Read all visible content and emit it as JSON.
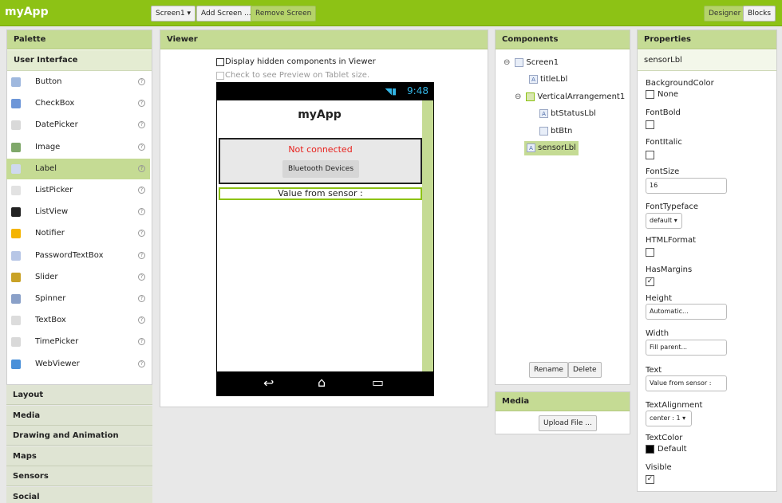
{
  "app": {
    "title": "myApp"
  },
  "toolbar": {
    "screen_select": "Screen1 ▾",
    "add_screen": "Add Screen ...",
    "remove_screen": "Remove Screen",
    "designer": "Designer",
    "blocks": "Blocks"
  },
  "palette": {
    "title": "Palette",
    "section": "User Interface",
    "items": [
      {
        "label": "Button",
        "icon": "button-icon"
      },
      {
        "label": "CheckBox",
        "icon": "checkbox-icon"
      },
      {
        "label": "DatePicker",
        "icon": "datepicker-icon"
      },
      {
        "label": "Image",
        "icon": "image-icon"
      },
      {
        "label": "Label",
        "icon": "label-icon",
        "selected": true
      },
      {
        "label": "ListPicker",
        "icon": "listpicker-icon"
      },
      {
        "label": "ListView",
        "icon": "listview-icon"
      },
      {
        "label": "Notifier",
        "icon": "notifier-icon"
      },
      {
        "label": "PasswordTextBox",
        "icon": "password-icon"
      },
      {
        "label": "Slider",
        "icon": "slider-icon"
      },
      {
        "label": "Spinner",
        "icon": "spinner-icon"
      },
      {
        "label": "TextBox",
        "icon": "textbox-icon"
      },
      {
        "label": "TimePicker",
        "icon": "timepicker-icon"
      },
      {
        "label": "WebViewer",
        "icon": "webviewer-icon"
      }
    ],
    "categories": [
      "Layout",
      "Media",
      "Drawing and Animation",
      "Maps",
      "Sensors",
      "Social"
    ]
  },
  "viewer": {
    "title": "Viewer",
    "hidden_checkbox": "Display hidden components in Viewer",
    "tablet_checkbox": "Check to see Preview on Tablet size.",
    "phone": {
      "time": "9:48",
      "screen_title": "myApp",
      "status": "Not connected",
      "bt_button": "Bluetooth Devices",
      "sensor_text": "Value from sensor :"
    }
  },
  "components": {
    "title": "Components",
    "tree": {
      "screen": "Screen1",
      "title_lbl": "titleLbl",
      "arrangement": "VerticalArrangement1",
      "bt_status": "btStatusLbl",
      "bt_btn": "btBtn",
      "sensor_lbl": "sensorLbl"
    },
    "rename": "Rename",
    "delete": "Delete"
  },
  "media": {
    "title": "Media",
    "upload": "Upload File ..."
  },
  "properties": {
    "title": "Properties",
    "component": "sensorLbl",
    "bg_label": "BackgroundColor",
    "bg_value": "None",
    "fontbold_label": "FontBold",
    "fontitalic_label": "FontItalic",
    "fontsize_label": "FontSize",
    "fontsize_value": "16",
    "typeface_label": "FontTypeface",
    "typeface_value": "default ▾",
    "html_label": "HTMLFormat",
    "margins_label": "HasMargins",
    "height_label": "Height",
    "height_value": "Automatic...",
    "width_label": "Width",
    "width_value": "Fill parent...",
    "text_label": "Text",
    "text_value": "Value from sensor :",
    "align_label": "TextAlignment",
    "align_value": "center : 1 ▾",
    "textcolor_label": "TextColor",
    "textcolor_value": "Default",
    "visible_label": "Visible"
  },
  "colors": {
    "accent": "#8dc215",
    "header": "#c5db94",
    "status_red": "#e8201c"
  }
}
